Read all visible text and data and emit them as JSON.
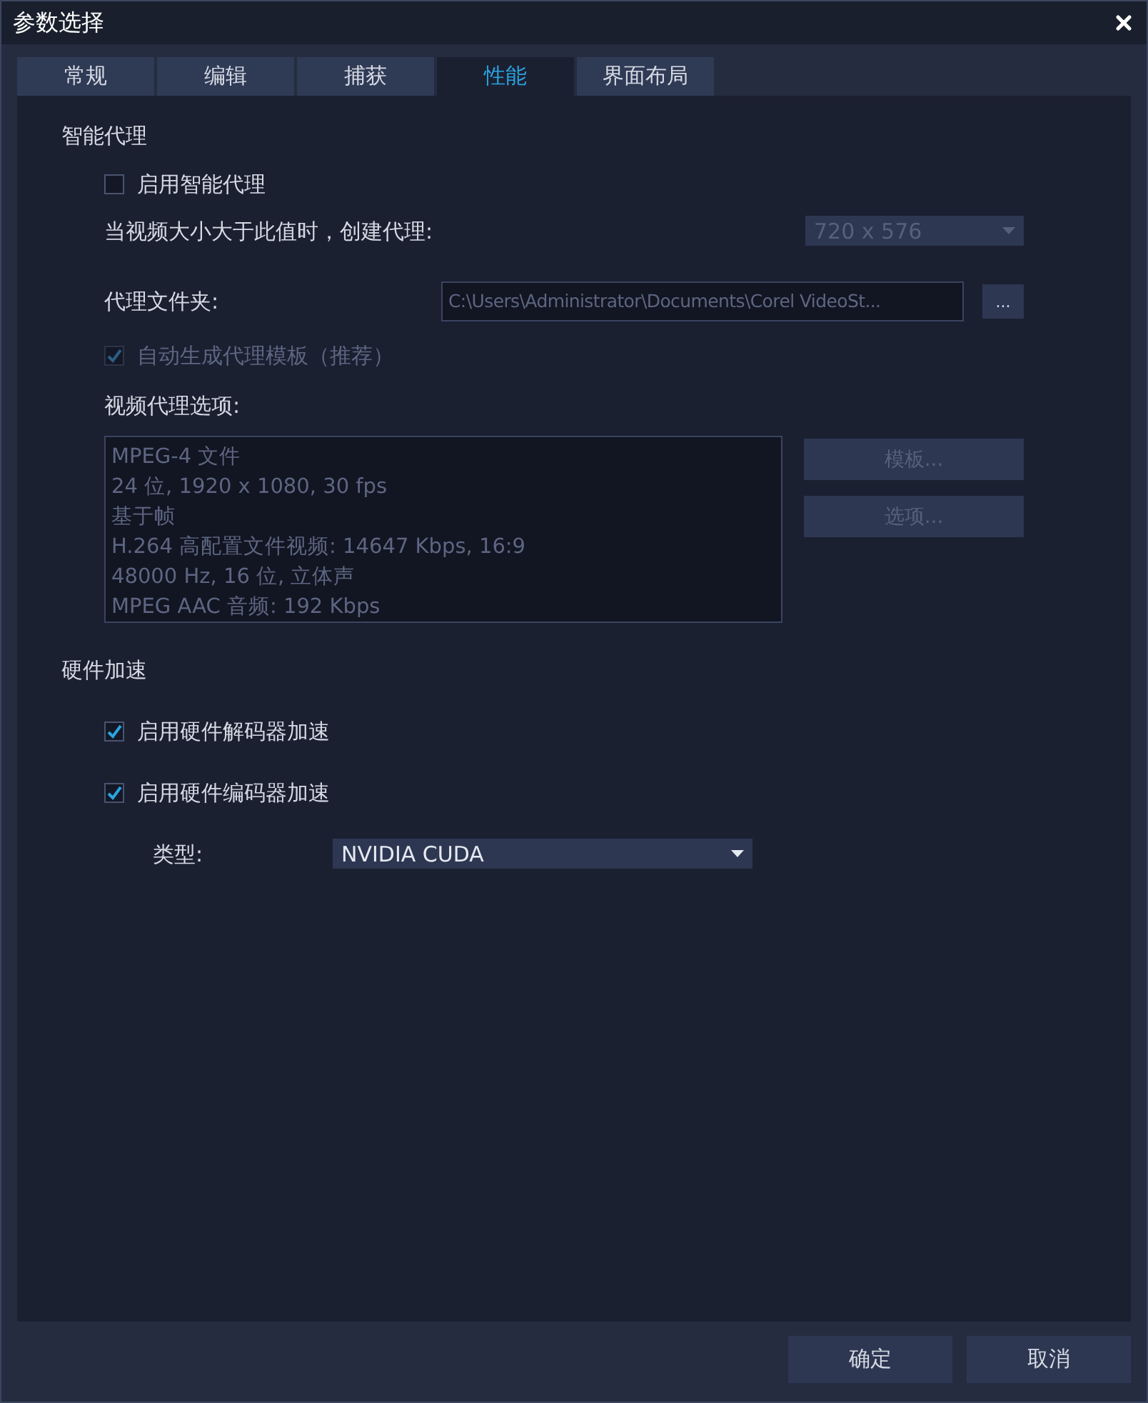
{
  "window": {
    "title": "参数选择"
  },
  "tabs": [
    {
      "label": "常规",
      "selected": false
    },
    {
      "label": "编辑",
      "selected": false
    },
    {
      "label": "捕获",
      "selected": false
    },
    {
      "label": "性能",
      "selected": true
    },
    {
      "label": "界面布局",
      "selected": false
    }
  ],
  "smart_proxy": {
    "heading": "智能代理",
    "enable": {
      "label": "启用智能代理",
      "checked": false,
      "disabled": false
    },
    "size": {
      "label": "当视频大小大于此值时，创建代理:",
      "value": "720 x 576",
      "disabled": true
    },
    "folder": {
      "label": "代理文件夹:",
      "value": "C:\\Users\\Administrator\\Documents\\Corel VideoSt...",
      "button": "...",
      "disabled": true
    },
    "auto_template": {
      "label": "自动生成代理模板（推荐）",
      "checked": true,
      "disabled": true
    },
    "options_label": "视频代理选项:",
    "options_lines": [
      "MPEG-4 文件",
      "24 位, 1920 x 1080, 30 fps",
      "基于帧",
      "H.264 高配置文件视频: 14647 Kbps, 16:9",
      "48000 Hz, 16 位, 立体声",
      "MPEG AAC 音频: 192 Kbps"
    ],
    "buttons": [
      {
        "label": "模板...",
        "disabled": true
      },
      {
        "label": "选项...",
        "disabled": true
      }
    ]
  },
  "hardware": {
    "heading": "硬件加速",
    "checkboxes": [
      {
        "label": "启用硬件解码器加速",
        "checked": true,
        "disabled": false
      },
      {
        "label": "启用硬件编码器加速",
        "checked": true,
        "disabled": false
      }
    ],
    "type": {
      "label": "类型:",
      "value": "NVIDIA CUDA",
      "disabled": false
    }
  },
  "footer_buttons": [
    "确定",
    "取消"
  ]
}
